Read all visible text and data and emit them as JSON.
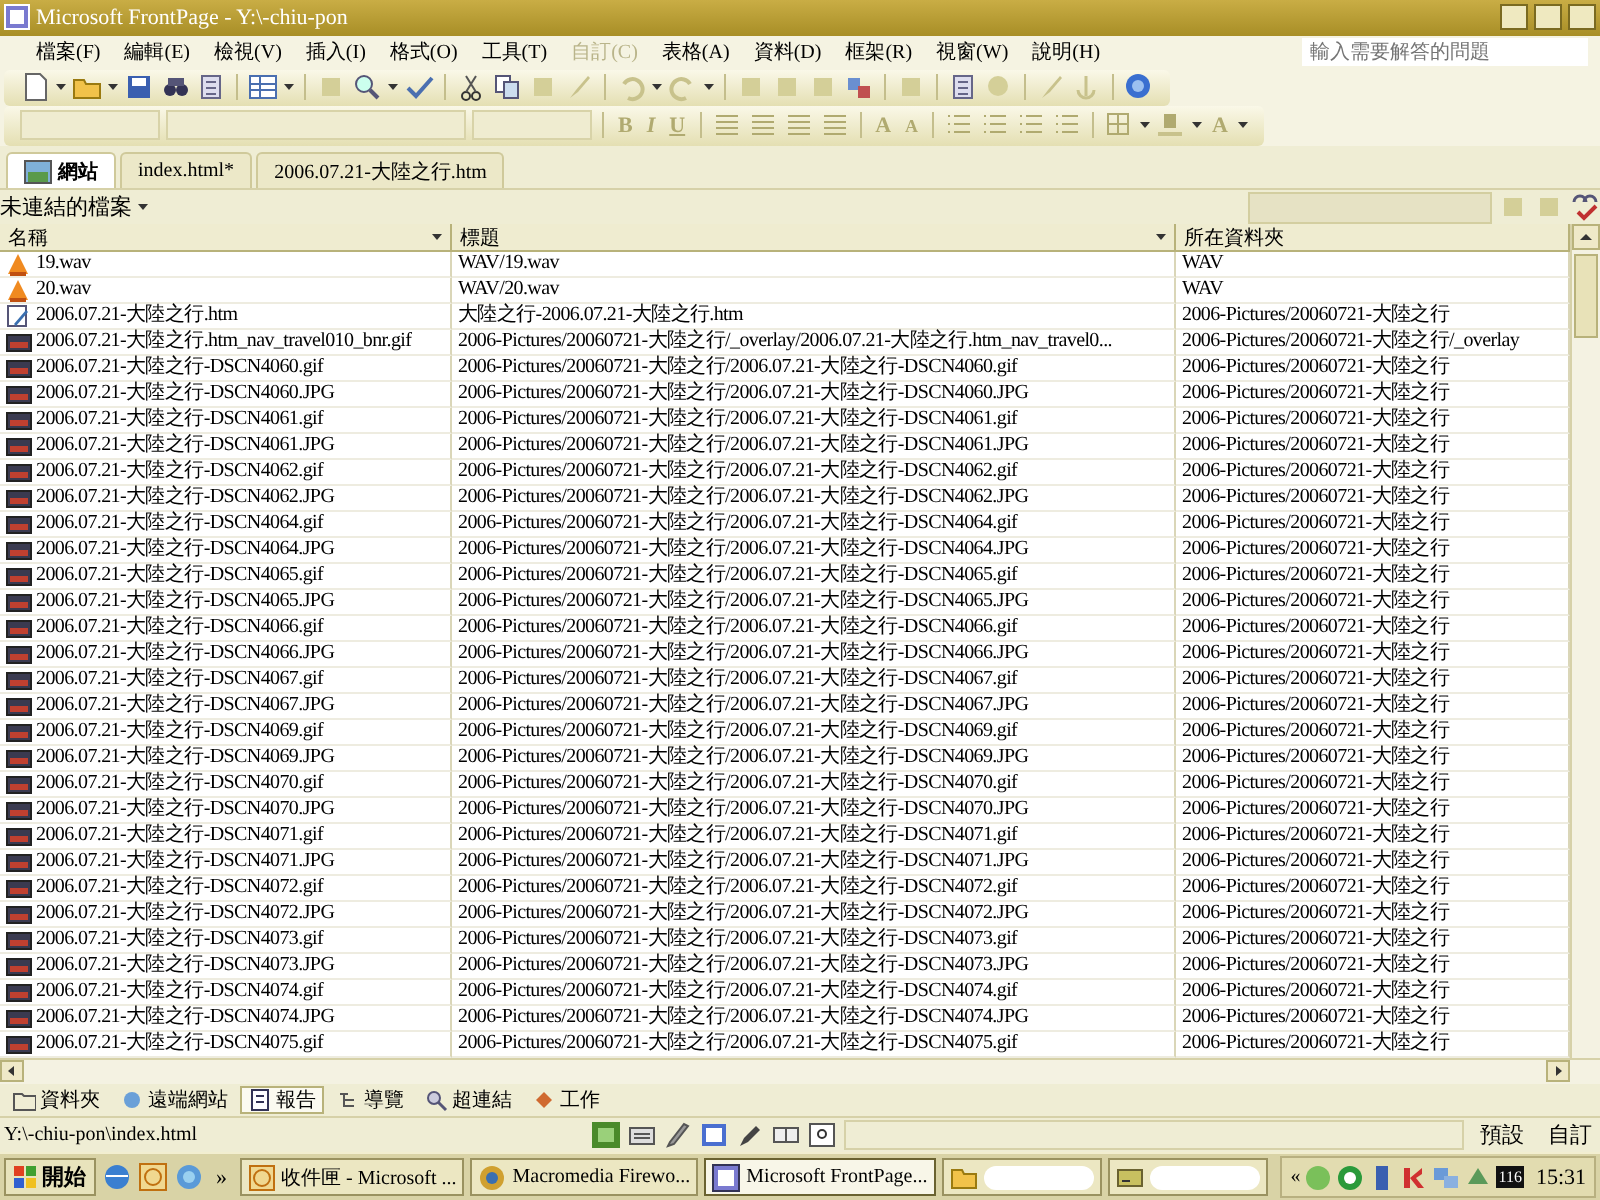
{
  "window": {
    "title": "Microsoft FrontPage - Y:\\-chiu-pon"
  },
  "menu": [
    {
      "label": "檔案(F)",
      "disabled": false
    },
    {
      "label": "編輯(E)",
      "disabled": false
    },
    {
      "label": "檢視(V)",
      "disabled": false
    },
    {
      "label": "插入(I)",
      "disabled": false
    },
    {
      "label": "格式(O)",
      "disabled": false
    },
    {
      "label": "工具(T)",
      "disabled": false
    },
    {
      "label": "自訂(C)",
      "disabled": true
    },
    {
      "label": "表格(A)",
      "disabled": false
    },
    {
      "label": "資料(D)",
      "disabled": false
    },
    {
      "label": "框架(R)",
      "disabled": false
    },
    {
      "label": "視窗(W)",
      "disabled": false
    },
    {
      "label": "說明(H)",
      "disabled": false
    }
  ],
  "help_search": {
    "placeholder": "輸入需要解答的問題"
  },
  "format_toolbar": {
    "style_buttons": [
      "B",
      "I",
      "U"
    ],
    "size_buttons": [
      "A",
      "A"
    ],
    "color_button": "A"
  },
  "tabs": [
    {
      "label": "網站",
      "selected": true,
      "kind": "site"
    },
    {
      "label": "index.html*",
      "selected": false,
      "kind": "page"
    },
    {
      "label": "2006.07.21-大陸之行.htm",
      "selected": false,
      "kind": "page"
    }
  ],
  "report": {
    "title": "未連結的檔案"
  },
  "table": {
    "columns": [
      "名稱",
      "標題",
      "所在資料夾"
    ],
    "rows": [
      {
        "kind": "wav",
        "name": "19.wav",
        "title": "WAV/19.wav",
        "folder": "WAV"
      },
      {
        "kind": "wav",
        "name": "20.wav",
        "title": "WAV/20.wav",
        "folder": "WAV"
      },
      {
        "kind": "htm",
        "name": "2006.07.21-大陸之行.htm",
        "title": "大陸之行-2006.07.21-大陸之行.htm",
        "folder": "2006-Pictures/20060721-大陸之行"
      },
      {
        "kind": "image",
        "name": "2006.07.21-大陸之行.htm_nav_travel010_bnr.gif",
        "title": "2006-Pictures/20060721-大陸之行/_overlay/2006.07.21-大陸之行.htm_nav_travel0...",
        "folder": "2006-Pictures/20060721-大陸之行/_overlay"
      },
      {
        "kind": "image",
        "name": "2006.07.21-大陸之行-DSCN4060.gif",
        "title": "2006-Pictures/20060721-大陸之行/2006.07.21-大陸之行-DSCN4060.gif",
        "folder": "2006-Pictures/20060721-大陸之行"
      },
      {
        "kind": "image",
        "name": "2006.07.21-大陸之行-DSCN4060.JPG",
        "title": "2006-Pictures/20060721-大陸之行/2006.07.21-大陸之行-DSCN4060.JPG",
        "folder": "2006-Pictures/20060721-大陸之行"
      },
      {
        "kind": "image",
        "name": "2006.07.21-大陸之行-DSCN4061.gif",
        "title": "2006-Pictures/20060721-大陸之行/2006.07.21-大陸之行-DSCN4061.gif",
        "folder": "2006-Pictures/20060721-大陸之行"
      },
      {
        "kind": "image",
        "name": "2006.07.21-大陸之行-DSCN4061.JPG",
        "title": "2006-Pictures/20060721-大陸之行/2006.07.21-大陸之行-DSCN4061.JPG",
        "folder": "2006-Pictures/20060721-大陸之行"
      },
      {
        "kind": "image",
        "name": "2006.07.21-大陸之行-DSCN4062.gif",
        "title": "2006-Pictures/20060721-大陸之行/2006.07.21-大陸之行-DSCN4062.gif",
        "folder": "2006-Pictures/20060721-大陸之行"
      },
      {
        "kind": "image",
        "name": "2006.07.21-大陸之行-DSCN4062.JPG",
        "title": "2006-Pictures/20060721-大陸之行/2006.07.21-大陸之行-DSCN4062.JPG",
        "folder": "2006-Pictures/20060721-大陸之行"
      },
      {
        "kind": "image",
        "name": "2006.07.21-大陸之行-DSCN4064.gif",
        "title": "2006-Pictures/20060721-大陸之行/2006.07.21-大陸之行-DSCN4064.gif",
        "folder": "2006-Pictures/20060721-大陸之行"
      },
      {
        "kind": "image",
        "name": "2006.07.21-大陸之行-DSCN4064.JPG",
        "title": "2006-Pictures/20060721-大陸之行/2006.07.21-大陸之行-DSCN4064.JPG",
        "folder": "2006-Pictures/20060721-大陸之行"
      },
      {
        "kind": "image",
        "name": "2006.07.21-大陸之行-DSCN4065.gif",
        "title": "2006-Pictures/20060721-大陸之行/2006.07.21-大陸之行-DSCN4065.gif",
        "folder": "2006-Pictures/20060721-大陸之行"
      },
      {
        "kind": "image",
        "name": "2006.07.21-大陸之行-DSCN4065.JPG",
        "title": "2006-Pictures/20060721-大陸之行/2006.07.21-大陸之行-DSCN4065.JPG",
        "folder": "2006-Pictures/20060721-大陸之行"
      },
      {
        "kind": "image",
        "name": "2006.07.21-大陸之行-DSCN4066.gif",
        "title": "2006-Pictures/20060721-大陸之行/2006.07.21-大陸之行-DSCN4066.gif",
        "folder": "2006-Pictures/20060721-大陸之行"
      },
      {
        "kind": "image",
        "name": "2006.07.21-大陸之行-DSCN4066.JPG",
        "title": "2006-Pictures/20060721-大陸之行/2006.07.21-大陸之行-DSCN4066.JPG",
        "folder": "2006-Pictures/20060721-大陸之行"
      },
      {
        "kind": "image",
        "name": "2006.07.21-大陸之行-DSCN4067.gif",
        "title": "2006-Pictures/20060721-大陸之行/2006.07.21-大陸之行-DSCN4067.gif",
        "folder": "2006-Pictures/20060721-大陸之行"
      },
      {
        "kind": "image",
        "name": "2006.07.21-大陸之行-DSCN4067.JPG",
        "title": "2006-Pictures/20060721-大陸之行/2006.07.21-大陸之行-DSCN4067.JPG",
        "folder": "2006-Pictures/20060721-大陸之行"
      },
      {
        "kind": "image",
        "name": "2006.07.21-大陸之行-DSCN4069.gif",
        "title": "2006-Pictures/20060721-大陸之行/2006.07.21-大陸之行-DSCN4069.gif",
        "folder": "2006-Pictures/20060721-大陸之行"
      },
      {
        "kind": "image",
        "name": "2006.07.21-大陸之行-DSCN4069.JPG",
        "title": "2006-Pictures/20060721-大陸之行/2006.07.21-大陸之行-DSCN4069.JPG",
        "folder": "2006-Pictures/20060721-大陸之行"
      },
      {
        "kind": "image",
        "name": "2006.07.21-大陸之行-DSCN4070.gif",
        "title": "2006-Pictures/20060721-大陸之行/2006.07.21-大陸之行-DSCN4070.gif",
        "folder": "2006-Pictures/20060721-大陸之行"
      },
      {
        "kind": "image",
        "name": "2006.07.21-大陸之行-DSCN4070.JPG",
        "title": "2006-Pictures/20060721-大陸之行/2006.07.21-大陸之行-DSCN4070.JPG",
        "folder": "2006-Pictures/20060721-大陸之行"
      },
      {
        "kind": "image",
        "name": "2006.07.21-大陸之行-DSCN4071.gif",
        "title": "2006-Pictures/20060721-大陸之行/2006.07.21-大陸之行-DSCN4071.gif",
        "folder": "2006-Pictures/20060721-大陸之行"
      },
      {
        "kind": "image",
        "name": "2006.07.21-大陸之行-DSCN4071.JPG",
        "title": "2006-Pictures/20060721-大陸之行/2006.07.21-大陸之行-DSCN4071.JPG",
        "folder": "2006-Pictures/20060721-大陸之行"
      },
      {
        "kind": "image",
        "name": "2006.07.21-大陸之行-DSCN4072.gif",
        "title": "2006-Pictures/20060721-大陸之行/2006.07.21-大陸之行-DSCN4072.gif",
        "folder": "2006-Pictures/20060721-大陸之行"
      },
      {
        "kind": "image",
        "name": "2006.07.21-大陸之行-DSCN4072.JPG",
        "title": "2006-Pictures/20060721-大陸之行/2006.07.21-大陸之行-DSCN4072.JPG",
        "folder": "2006-Pictures/20060721-大陸之行"
      },
      {
        "kind": "image",
        "name": "2006.07.21-大陸之行-DSCN4073.gif",
        "title": "2006-Pictures/20060721-大陸之行/2006.07.21-大陸之行-DSCN4073.gif",
        "folder": "2006-Pictures/20060721-大陸之行"
      },
      {
        "kind": "image",
        "name": "2006.07.21-大陸之行-DSCN4073.JPG",
        "title": "2006-Pictures/20060721-大陸之行/2006.07.21-大陸之行-DSCN4073.JPG",
        "folder": "2006-Pictures/20060721-大陸之行"
      },
      {
        "kind": "image",
        "name": "2006.07.21-大陸之行-DSCN4074.gif",
        "title": "2006-Pictures/20060721-大陸之行/2006.07.21-大陸之行-DSCN4074.gif",
        "folder": "2006-Pictures/20060721-大陸之行"
      },
      {
        "kind": "image",
        "name": "2006.07.21-大陸之行-DSCN4074.JPG",
        "title": "2006-Pictures/20060721-大陸之行/2006.07.21-大陸之行-DSCN4074.JPG",
        "folder": "2006-Pictures/20060721-大陸之行"
      },
      {
        "kind": "image",
        "name": "2006.07.21-大陸之行-DSCN4075.gif",
        "title": "2006-Pictures/20060721-大陸之行/2006.07.21-大陸之行-DSCN4075.gif",
        "folder": "2006-Pictures/20060721-大陸之行"
      }
    ]
  },
  "views": [
    {
      "label": "資料夾",
      "selected": false
    },
    {
      "label": "遠端網站",
      "selected": false
    },
    {
      "label": "報告",
      "selected": true
    },
    {
      "label": "導覽",
      "selected": false
    },
    {
      "label": "超連結",
      "selected": false
    },
    {
      "label": "工作",
      "selected": false
    }
  ],
  "status_bar": {
    "path": "Y:\\-chiu-pon\\index.html",
    "mode": "預設",
    "custom": "自訂"
  },
  "taskbar": {
    "start": "開始",
    "more": "»",
    "tasks": [
      {
        "label": "收件匣 - Microsoft ...",
        "selected": false,
        "kind": "mail"
      },
      {
        "label": "Macromedia Firewo...",
        "selected": false,
        "kind": "app"
      },
      {
        "label": "Microsoft FrontPage...",
        "selected": true,
        "kind": "frontpage"
      },
      {
        "selected": false,
        "kind": "folder"
      },
      {
        "selected": false,
        "kind": "drive"
      }
    ],
    "tray_expand": "«",
    "tray_badge": "116",
    "clock": "15:31"
  }
}
